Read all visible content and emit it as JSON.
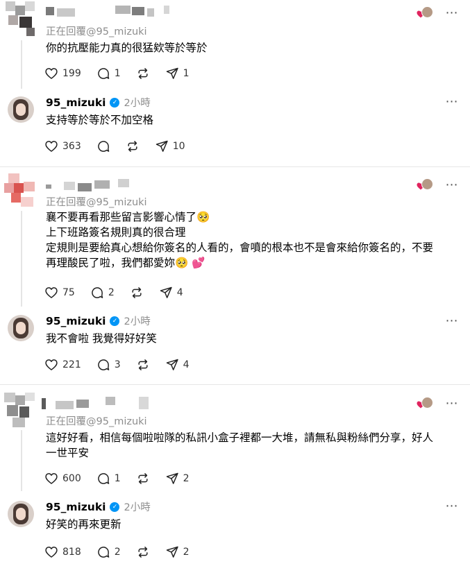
{
  "threads": [
    {
      "reply": {
        "replying_to": "正在回覆@95_mizuki",
        "lines": [
          "你的抗壓能力真的很猛欸等於等於"
        ],
        "likes": "199",
        "comments": "1",
        "shares": "1"
      },
      "author": {
        "username": "95_mizuki",
        "time": "2小時",
        "lines": [
          "支持等於等於不加空格"
        ],
        "likes": "363",
        "shares": "10"
      }
    },
    {
      "reply": {
        "replying_to": "正在回覆@95_mizuki",
        "lines": [
          "襄不要再看那些留言影響心情了🥺",
          "上下班路簽名規則真的很合理",
          "定規則是要給真心想給你簽名的人看的，會噴的根本也不是會來給你簽名的，不要",
          "再理酸民了啦，我們都愛妳🥺 💕"
        ],
        "likes": "75",
        "comments": "2",
        "shares": "4"
      },
      "author": {
        "username": "95_mizuki",
        "time": "2小時",
        "lines": [
          "我不會啦 我覺得好好笑"
        ],
        "likes": "221",
        "comments": "3",
        "shares": "4"
      }
    },
    {
      "reply": {
        "replying_to": "正在回覆@95_mizuki",
        "lines": [
          "這好好看，相信每個啦啦隊的私訊小盒子裡都一大堆，請無私與粉絲們分享，好人",
          "一世平安"
        ],
        "likes": "600",
        "comments": "1",
        "shares": "2"
      },
      "author": {
        "username": "95_mizuki",
        "time": "2小時",
        "lines": [
          "好笑的再來更新"
        ],
        "likes": "818",
        "comments": "2",
        "shares": "2"
      }
    }
  ],
  "icons": {
    "more": "⋯",
    "verified": "✓"
  },
  "colors": {
    "verified": "#0095f6",
    "heart": "#e0245e"
  }
}
